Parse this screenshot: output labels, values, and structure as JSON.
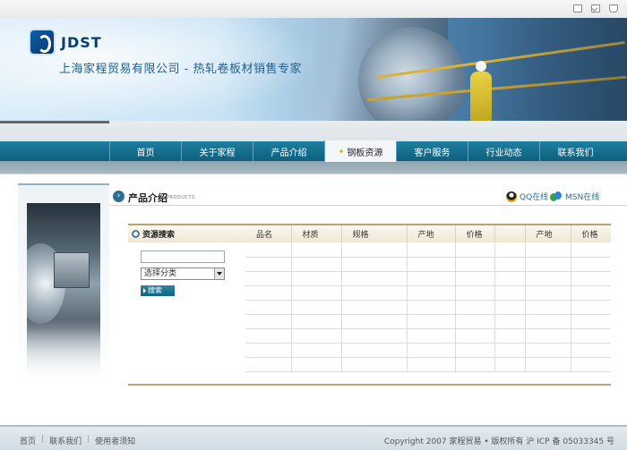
{
  "header": {
    "brand": "JDST",
    "tagline": "上海家程贸易有限公司 - 热轧卷板材销售专家",
    "util_icons": [
      "home-icon",
      "mail-icon",
      "favorite-icon"
    ]
  },
  "nav": {
    "items": [
      "首页",
      "关于家程",
      "产品介绍",
      "钢板资源",
      "客户服务",
      "行业动态",
      "联系我们"
    ],
    "active_index": 3
  },
  "section": {
    "title": "产品介绍",
    "subtitle": "PRODUCTS",
    "qq_label": "QQ在线",
    "msn_label": "MSN在线"
  },
  "search": {
    "title": "资源搜索",
    "keyword_value": "",
    "category_selected": "选择分类",
    "button_label": "搜索"
  },
  "table": {
    "columns": [
      "品名",
      "材质",
      "规格",
      "产地",
      "价格",
      "",
      "产地",
      "价格"
    ],
    "rows": 9
  },
  "footer": {
    "links": [
      "首页",
      "联系我们",
      "使用者须知"
    ],
    "copyright": "Copyright 2007 家程贸易 • 版权所有  沪 ICP 备 05033345 号"
  },
  "colors": {
    "nav_band": "#1e7fa0",
    "accent_border": "#b6a37a",
    "link_blue": "#2c6f95"
  }
}
